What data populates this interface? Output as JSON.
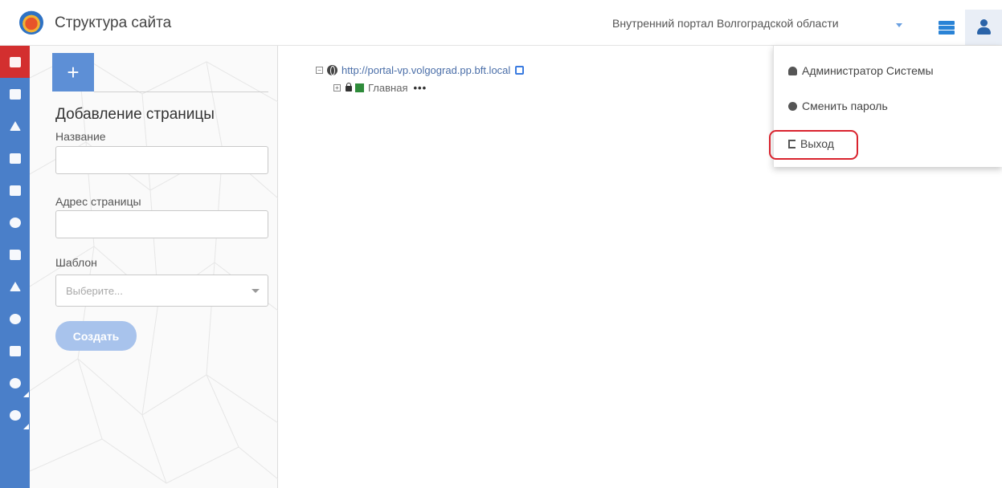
{
  "header": {
    "title": "Структура сайта",
    "portal": "Внутренний портал Волгоградской области"
  },
  "sidebar": {
    "items": [
      {
        "icon": "site-structure-icon",
        "active": true
      },
      {
        "icon": "tasks-icon"
      },
      {
        "icon": "sitemap-icon"
      },
      {
        "icon": "news-icon"
      },
      {
        "icon": "comments-icon"
      },
      {
        "icon": "help-icon"
      },
      {
        "icon": "folder-icon"
      },
      {
        "icon": "education-icon"
      },
      {
        "icon": "database-settings-icon"
      },
      {
        "icon": "statistics-icon"
      },
      {
        "icon": "user-icon"
      },
      {
        "icon": "users-group-icon"
      }
    ]
  },
  "panel": {
    "add_label": "+",
    "title": "Добавление страницы",
    "name_label": "Название",
    "name_value": "",
    "address_label": "Адрес страницы",
    "address_value": "",
    "template_label": "Шаблон",
    "template_placeholder": "Выберите...",
    "create_label": "Создать"
  },
  "tree": {
    "root_url": "http://portal-vp.volgograd.pp.bft.local",
    "child_label": "Главная",
    "more_label": "•••",
    "root_toggle": "−",
    "child_toggle": "+"
  },
  "user_menu": {
    "items": [
      {
        "label": "Администратор Системы",
        "icon": "user-icon"
      },
      {
        "label": "Сменить пароль",
        "icon": "gear-icon"
      },
      {
        "label": "Выход",
        "icon": "sign-out-icon"
      }
    ]
  },
  "colors": {
    "sidebar": "#4a7fc9",
    "sidebar_active": "#d32f2f",
    "accent": "#5d8fd6",
    "highlight": "#d9232e"
  }
}
